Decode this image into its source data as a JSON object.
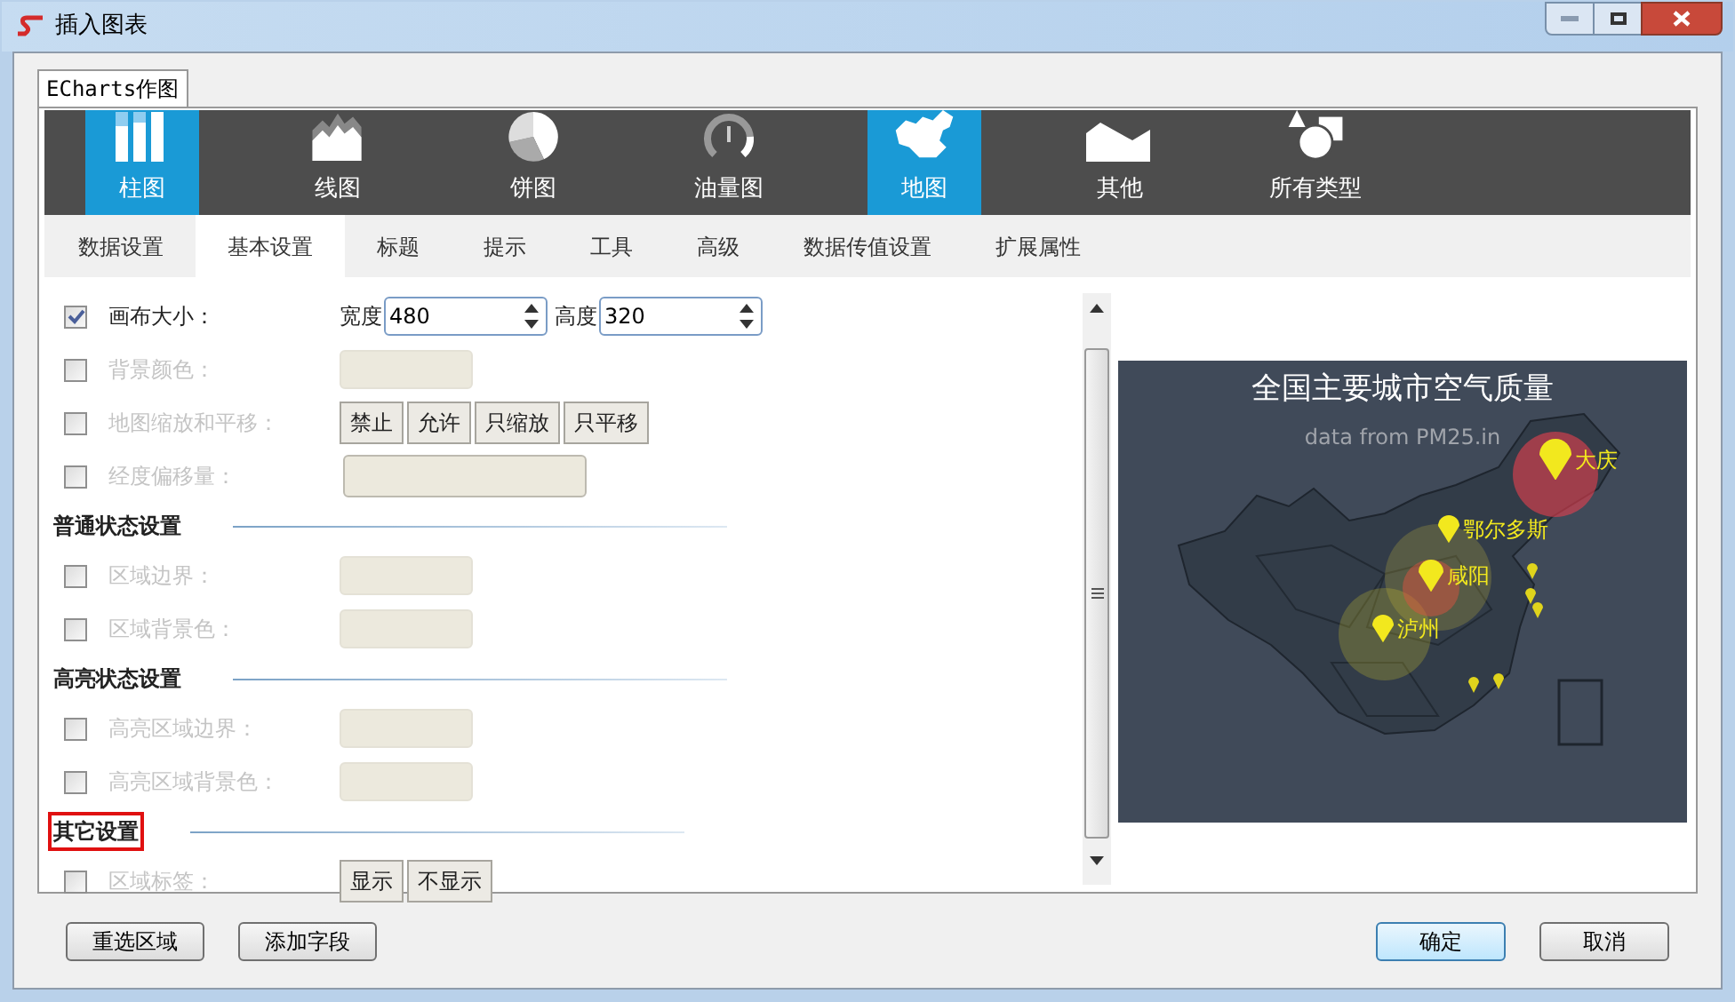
{
  "window": {
    "title": "插入图表"
  },
  "tab": {
    "label": "ECharts作图",
    "selected": true
  },
  "chart_types": [
    {
      "label": "柱图",
      "kind": "bar",
      "selected": true
    },
    {
      "label": "线图",
      "kind": "line",
      "selected": false
    },
    {
      "label": "饼图",
      "kind": "pie",
      "selected": false
    },
    {
      "label": "油量图",
      "kind": "gauge",
      "selected": false
    },
    {
      "label": "地图",
      "kind": "map",
      "selected": true
    },
    {
      "label": "其他",
      "kind": "other",
      "selected": false
    },
    {
      "label": "所有类型",
      "kind": "all",
      "selected": false
    }
  ],
  "sub_tabs": [
    {
      "label": "数据设置",
      "selected": false
    },
    {
      "label": "基本设置",
      "selected": true
    },
    {
      "label": "标题",
      "selected": false
    },
    {
      "label": "提示",
      "selected": false
    },
    {
      "label": "工具",
      "selected": false
    },
    {
      "label": "高级",
      "selected": false
    },
    {
      "label": "数据传值设置",
      "selected": false
    },
    {
      "label": "扩展属性",
      "selected": false
    }
  ],
  "settings": [
    {
      "kind": "row",
      "label": "画布大小：",
      "checked": true,
      "control": {
        "kind": "spinners",
        "spinners": [
          {
            "label": "宽度",
            "value": "480"
          },
          {
            "label": "高度",
            "value": "320"
          }
        ]
      }
    },
    {
      "kind": "row",
      "label": "背景颜色：",
      "checked": false,
      "control": {
        "kind": "field"
      }
    },
    {
      "kind": "row",
      "label": "地图缩放和平移：",
      "checked": false,
      "control": {
        "kind": "buttons",
        "buttons": [
          "禁止",
          "允许",
          "只缩放",
          "只平移"
        ]
      }
    },
    {
      "kind": "row",
      "label": "经度偏移量：",
      "checked": false,
      "control": {
        "kind": "wide_field"
      }
    },
    {
      "kind": "section",
      "title": "普通状态设置",
      "highlighted": false
    },
    {
      "kind": "row",
      "label": "区域边界：",
      "checked": false,
      "control": {
        "kind": "field"
      }
    },
    {
      "kind": "row",
      "label": "区域背景色：",
      "checked": false,
      "control": {
        "kind": "field"
      }
    },
    {
      "kind": "section",
      "title": "高亮状态设置",
      "highlighted": false
    },
    {
      "kind": "row",
      "label": "高亮区域边界：",
      "checked": false,
      "control": {
        "kind": "field"
      }
    },
    {
      "kind": "row",
      "label": "高亮区域背景色：",
      "checked": false,
      "control": {
        "kind": "field"
      }
    },
    {
      "kind": "section",
      "title": "其它设置",
      "highlighted": true
    },
    {
      "kind": "row",
      "label": "区域标签：",
      "checked": false,
      "control": {
        "kind": "buttons",
        "buttons": [
          "显示",
          "不显示"
        ]
      }
    }
  ],
  "preview": {
    "title": "全国主要城市空气质量",
    "subtitle": "data from PM25.in",
    "cities": [
      "大庆",
      "鄂尔多斯",
      "咸阳",
      "泸州"
    ]
  },
  "footer": {
    "left_buttons": [
      "重选区域",
      "添加字段"
    ],
    "right_buttons": [
      {
        "label": "确定",
        "default": true
      },
      {
        "label": "取消",
        "default": false
      }
    ]
  }
}
